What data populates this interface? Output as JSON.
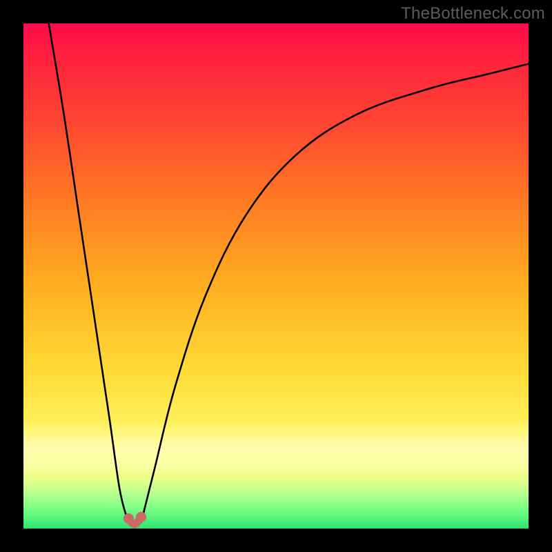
{
  "attribution": "TheBottleneck.com",
  "colors": {
    "frame": "#000000",
    "curve": "#000000",
    "marker": "#c96a66",
    "gradient_top": "#ff0a4a",
    "gradient_bottom": "#2fe56e"
  },
  "chart_data": {
    "type": "line",
    "title": "",
    "xlabel": "",
    "ylabel": "",
    "xlim": [
      0,
      100
    ],
    "ylim": [
      0,
      100
    ],
    "note": "V-shaped bottleneck curve over a red-to-green vertical gradient. Axis values are estimated from pixel positions; no tick labels appear in the image.",
    "series": [
      {
        "name": "left-limb",
        "x": [
          5,
          8,
          11,
          14,
          17,
          19,
          20.5
        ],
        "y": [
          100,
          82,
          62,
          42,
          22,
          8,
          2
        ]
      },
      {
        "name": "valley",
        "x": [
          20.5,
          21.2,
          22.0,
          22.8,
          23.5
        ],
        "y": [
          2,
          0.8,
          0.6,
          0.8,
          2
        ]
      },
      {
        "name": "right-limb",
        "x": [
          23.5,
          26,
          30,
          36,
          44,
          54,
          66,
          80,
          92,
          100
        ],
        "y": [
          2,
          12,
          28,
          46,
          62,
          74,
          82,
          87,
          90,
          92
        ]
      }
    ],
    "markers": [
      {
        "x": 20.8,
        "y": 2.0
      },
      {
        "x": 23.3,
        "y": 2.3
      }
    ],
    "valley_segment": {
      "x": [
        20.8,
        21.6,
        22.3,
        23.3
      ],
      "y": [
        2.0,
        1.0,
        1.0,
        2.3
      ]
    }
  }
}
